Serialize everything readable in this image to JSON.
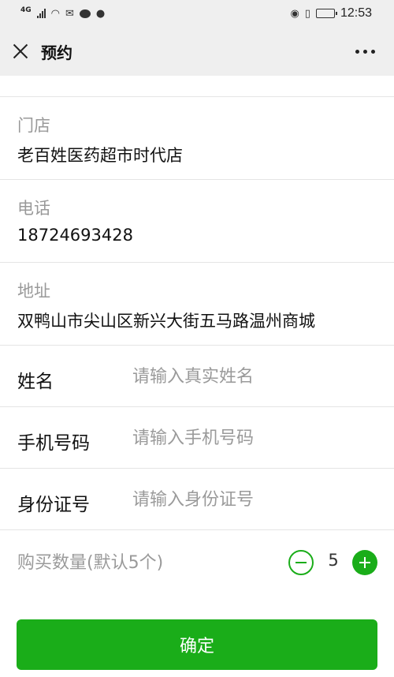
{
  "status_bar": {
    "network": "4G",
    "time": "12:53"
  },
  "nav": {
    "title": "预约"
  },
  "store": {
    "store_label": "门店",
    "store_value": "老百姓医药超市时代店",
    "phone_label": "电话",
    "phone_value": "18724693428",
    "address_label": "地址",
    "address_value": "双鸭山市尖山区新兴大街五马路温州商城"
  },
  "form": {
    "name_label": "姓名",
    "name_placeholder": "请输入真实姓名",
    "mobile_label": "手机号码",
    "mobile_placeholder": "请输入手机号码",
    "id_label": "身份证号",
    "id_placeholder": "请输入身份证号"
  },
  "quantity": {
    "label": "购买数量(默认5个)",
    "value": "5"
  },
  "confirm_label": "确定",
  "colors": {
    "accent": "#1aad19",
    "label_gray": "#999999",
    "header_bg": "#efefef"
  }
}
